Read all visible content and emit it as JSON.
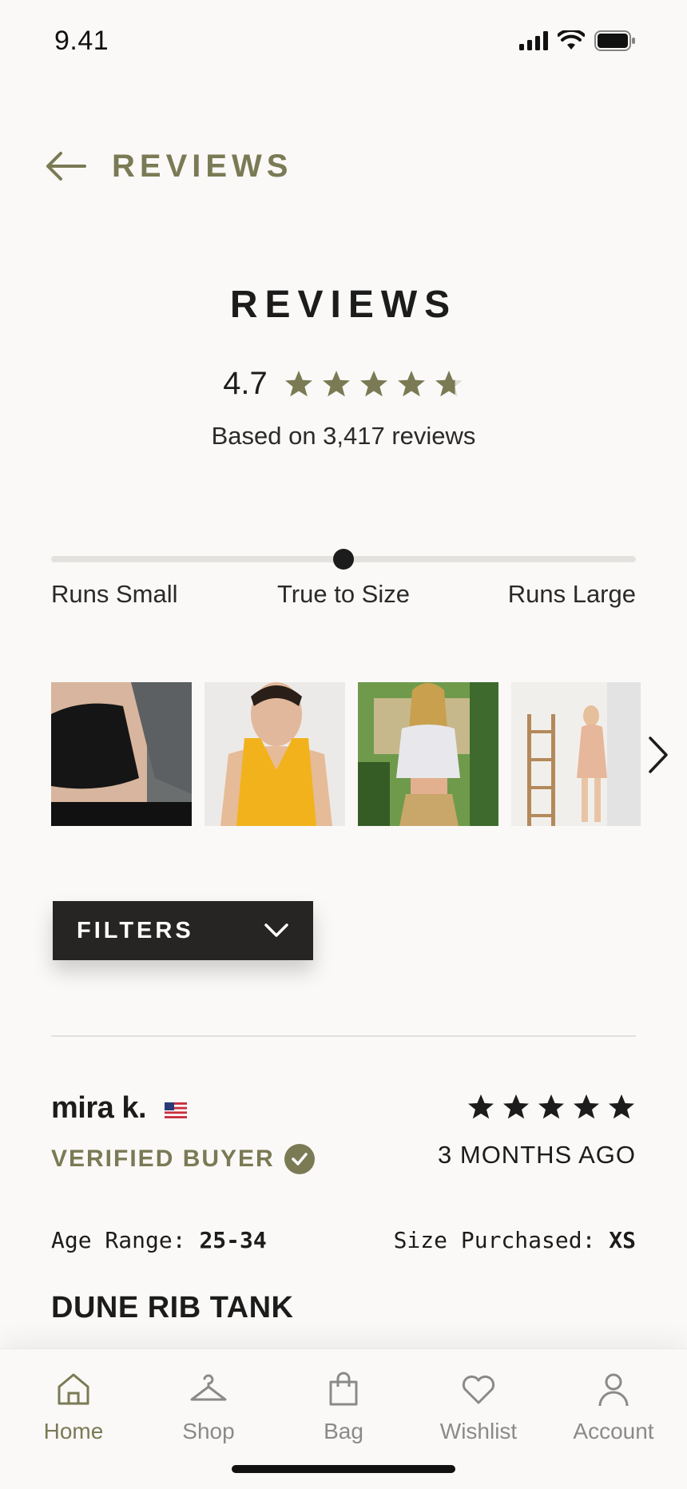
{
  "status_bar": {
    "time": "9.41"
  },
  "header": {
    "title": "REVIEWS"
  },
  "summary": {
    "heading": "REVIEWS",
    "rating": "4.7",
    "rating_value": 4.7,
    "based_on": "Based on 3,417 reviews"
  },
  "fit": {
    "left_label": "Runs Small",
    "middle_label": "True to Size",
    "right_label": "Runs Large",
    "level": 0.5
  },
  "photos": [
    {
      "name": "black rib top photo"
    },
    {
      "name": "yellow tank photo"
    },
    {
      "name": "white crop top photo"
    },
    {
      "name": "peach set photo"
    }
  ],
  "filters": {
    "label": "FILTERS"
  },
  "review": {
    "name": "mira k.",
    "badge": "VERIFIED BUYER",
    "stars": 5,
    "date": "3 MONTHS AGO",
    "age_label": "Age Range: ",
    "age_value": "25-34",
    "size_label": "Size Purchased: ",
    "size_value": "XS",
    "product": "DUNE RIB TANK"
  },
  "tabs": [
    {
      "label": "Home",
      "icon": "home-icon",
      "active": true
    },
    {
      "label": "Shop",
      "icon": "hanger-icon",
      "active": false
    },
    {
      "label": "Bag",
      "icon": "bag-icon",
      "active": false
    },
    {
      "label": "Wishlist",
      "icon": "heart-icon",
      "active": false
    },
    {
      "label": "Account",
      "icon": "user-icon",
      "active": false
    }
  ],
  "colors": {
    "accent": "#7a7a55",
    "dark": "#262523",
    "background": "#faf9f7",
    "star_empty": "#dcdcd2"
  }
}
